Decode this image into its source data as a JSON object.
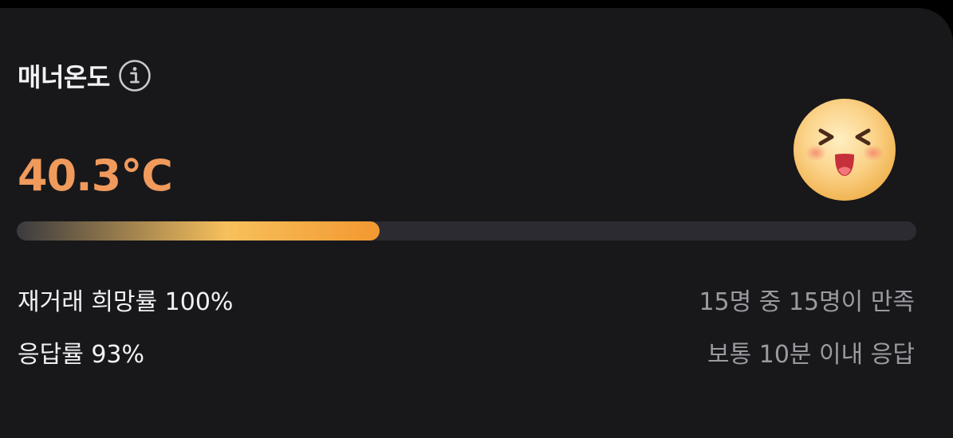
{
  "manner_temp": {
    "title": "매너온도",
    "info_icon": "info-icon",
    "temperature_text": "40.3°C",
    "temperature_value": 40.3,
    "progress": 0.403,
    "emoji_icon": "laughing-face-icon",
    "colors": {
      "card_bg": "#18181b",
      "title": "#f2f2f4",
      "temperature": "#f09a5c",
      "track": "#2b2b31",
      "fill_start": "#3a3a3e",
      "fill_mid": "#f7c05c",
      "fill_end": "#f39830",
      "secondary_text": "#9a9aa0"
    }
  },
  "stats": {
    "rehire_label": "재거래 희망률 100%",
    "rehire_detail": "15명 중 15명이 만족",
    "response_label": "응답률 93%",
    "response_detail": "보통 10분 이내 응답"
  }
}
